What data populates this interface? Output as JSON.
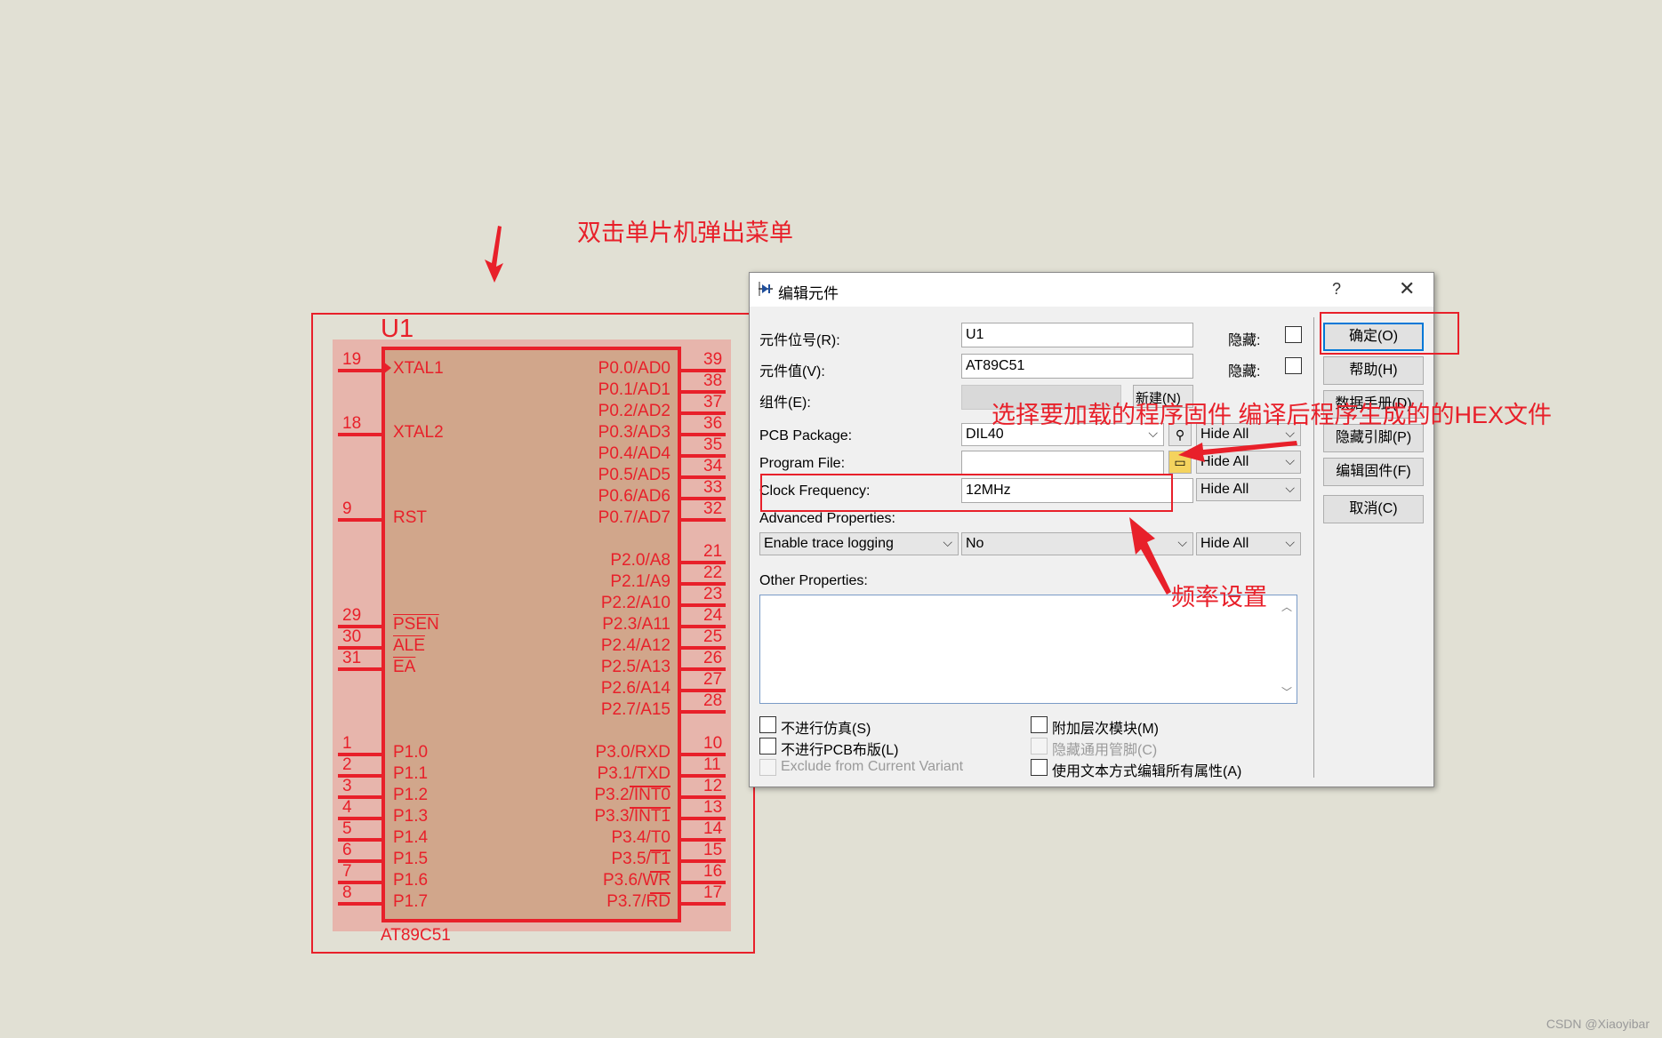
{
  "schematic": {
    "ref": "U1",
    "part": "AT89C51",
    "left_pins": [
      {
        "num": "19",
        "label": "XTAL1"
      },
      {
        "num": "18",
        "label": "XTAL2"
      },
      {
        "num": "9",
        "label": "RST"
      },
      {
        "num": "29",
        "label": "PSEN"
      },
      {
        "num": "30",
        "label": "ALE"
      },
      {
        "num": "31",
        "label": "EA"
      },
      {
        "num": "1",
        "label": "P1.0"
      },
      {
        "num": "2",
        "label": "P1.1"
      },
      {
        "num": "3",
        "label": "P1.2"
      },
      {
        "num": "4",
        "label": "P1.3"
      },
      {
        "num": "5",
        "label": "P1.4"
      },
      {
        "num": "6",
        "label": "P1.5"
      },
      {
        "num": "7",
        "label": "P1.6"
      },
      {
        "num": "8",
        "label": "P1.7"
      }
    ],
    "right_pins": [
      {
        "num": "39",
        "label": "P0.0/AD0"
      },
      {
        "num": "38",
        "label": "P0.1/AD1"
      },
      {
        "num": "37",
        "label": "P0.2/AD2"
      },
      {
        "num": "36",
        "label": "P0.3/AD3"
      },
      {
        "num": "35",
        "label": "P0.4/AD4"
      },
      {
        "num": "34",
        "label": "P0.5/AD5"
      },
      {
        "num": "33",
        "label": "P0.6/AD6"
      },
      {
        "num": "32",
        "label": "P0.7/AD7"
      },
      {
        "num": "21",
        "label": "P2.0/A8"
      },
      {
        "num": "22",
        "label": "P2.1/A9"
      },
      {
        "num": "23",
        "label": "P2.2/A10"
      },
      {
        "num": "24",
        "label": "P2.3/A11"
      },
      {
        "num": "25",
        "label": "P2.4/A12"
      },
      {
        "num": "26",
        "label": "P2.5/A13"
      },
      {
        "num": "27",
        "label": "P2.6/A14"
      },
      {
        "num": "28",
        "label": "P2.7/A15"
      },
      {
        "num": "10",
        "label": "P3.0/RXD"
      },
      {
        "num": "11",
        "label": "P3.1/TXD"
      },
      {
        "num": "12",
        "label": "P3.2/INT0"
      },
      {
        "num": "13",
        "label": "P3.3/INT1"
      },
      {
        "num": "14",
        "label": "P3.4/T0"
      },
      {
        "num": "15",
        "label": "P3.5/T1"
      },
      {
        "num": "16",
        "label": "P3.6/WR"
      },
      {
        "num": "17",
        "label": "P3.7/RD"
      }
    ]
  },
  "dialog": {
    "title": "编辑元件",
    "help": "?",
    "close": "✕",
    "fields": {
      "ref_label": "元件位号(R):",
      "ref_value": "U1",
      "value_label": "元件值(V):",
      "value_value": "AT89C51",
      "group_label": "组件(E):",
      "new_button": "新建(N)",
      "hidden_label": "隐藏:",
      "pcb_label": "PCB Package:",
      "pcb_value": "DIL40",
      "program_label": "Program File:",
      "program_value": "",
      "clock_label": "Clock Frequency:",
      "clock_value": "12MHz",
      "hide_all": "Hide All",
      "advanced_label": "Advanced Properties:",
      "advanced_prop": "Enable trace logging",
      "advanced_value": "No",
      "other_label": "Other Properties:"
    },
    "checkboxes": {
      "no_sim": "不进行仿真(S)",
      "no_pcb": "不进行PCB布版(L)",
      "exclude_variant": "Exclude from Current Variant",
      "attach_module": "附加层次模块(M)",
      "hide_pins": "隐藏通用管脚(C)",
      "edit_text": "使用文本方式编辑所有属性(A)"
    },
    "buttons": {
      "ok": "确定(O)",
      "help": "帮助(H)",
      "datasheet": "数据手册(D)",
      "hidden_pins": "隐藏引脚(P)",
      "edit_firmware": "编辑固件(F)",
      "cancel": "取消(C)"
    }
  },
  "annotations": {
    "top": "双击单片机弹出菜单",
    "program": "选择要加载的程序固件 编译后程序生成的的HEX文件",
    "freq": "频率设置"
  },
  "watermark": "CSDN @Xiaoyibar",
  "colors": {
    "annotation": "#e8202a",
    "chip_fill": "#d1a68b",
    "background": "#e1e0d4",
    "accent": "#0078d7"
  }
}
